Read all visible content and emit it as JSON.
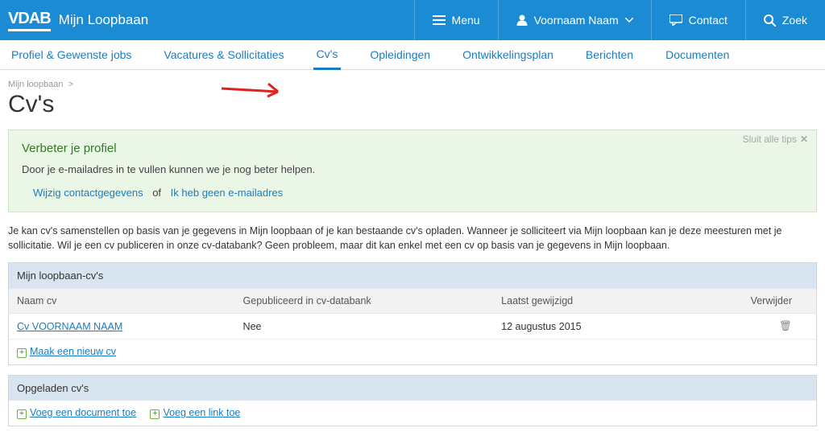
{
  "topbar": {
    "logo": "VDAB",
    "title": "Mijn Loopbaan",
    "menu": "Menu",
    "user": "Voornaam Naam",
    "contact": "Contact",
    "search": "Zoek"
  },
  "subnav": {
    "items": [
      "Profiel & Gewenste jobs",
      "Vacatures & Sollicitaties",
      "Cv's",
      "Opleidingen",
      "Ontwikkelingsplan",
      "Berichten",
      "Documenten"
    ],
    "active_index": 2
  },
  "breadcrumb": "Mijn loopbaan",
  "page_title": "Cv's",
  "tip": {
    "close": "Sluit alle tips",
    "heading": "Verbeter je profiel",
    "body": "Door je e-mailadres in te vullen kunnen we je nog beter helpen.",
    "action1": "Wijzig contactgegevens",
    "of": "of",
    "action2": "Ik heb geen e-mailadres"
  },
  "intro": "Je kan cv's samenstellen op basis van je gegevens in Mijn loopbaan of je kan bestaande cv's opladen. Wanneer je solliciteert via Mijn loopbaan kan je deze meesturen met je sollicitatie. Wil je een cv publiceren in onze cv-databank? Geen probleem, maar dit kan enkel met een cv op basis van je gegevens in Mijn loopbaan.",
  "panel1": {
    "title": "Mijn loopbaan-cv's",
    "cols": [
      "Naam cv",
      "Gepubliceerd in cv-databank",
      "Laatst gewijzigd",
      "Verwijder"
    ],
    "rows": [
      {
        "name": "Cv VOORNAAM NAAM",
        "pub": "Nee",
        "date": "12 augustus 2015"
      }
    ],
    "add": "Maak een nieuw cv"
  },
  "panel2": {
    "title": "Opgeladen cv's",
    "add_doc": "Voeg een document toe",
    "add_link": "Voeg een link toe"
  }
}
